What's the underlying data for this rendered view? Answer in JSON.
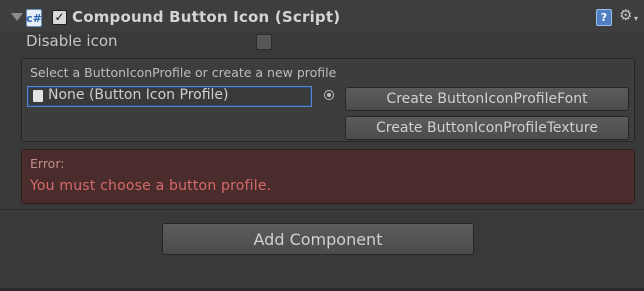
{
  "component": {
    "title": "Compound Button Icon (Script)",
    "enabled": true,
    "script_icon_glyph": "c#",
    "help_glyph": "?",
    "gear_glyph": "⚙",
    "caret_glyph": "▾"
  },
  "disable_icon": {
    "label": "Disable icon",
    "checked": false
  },
  "profile_box": {
    "caption": "Select a ButtonIconProfile or create a new profile",
    "field_value": "None (Button Icon Profile)",
    "create_font_label": "Create ButtonIconProfileFont",
    "create_texture_label": "Create ButtonIconProfileTexture"
  },
  "error": {
    "title": "Error:",
    "message": "You must choose a button profile."
  },
  "add_component_label": "Add Component",
  "colors": {
    "background": "#393939",
    "error_bg": "#4a2c2c",
    "error_text": "#d66a6a",
    "field_focus": "#5c84c4"
  },
  "icons": [
    "foldout-arrow-icon",
    "script-icon",
    "checkbox-icon",
    "help-icon",
    "gear-icon",
    "document-icon",
    "object-picker-icon"
  ]
}
